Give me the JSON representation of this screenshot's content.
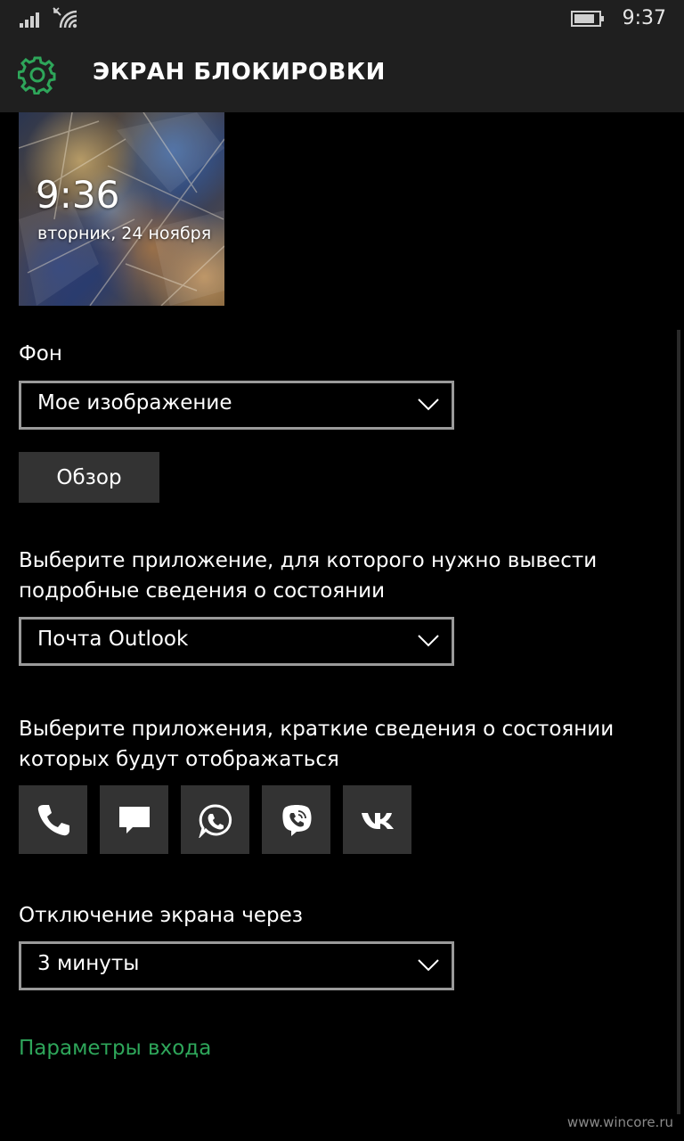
{
  "status_bar": {
    "time": "9:37"
  },
  "header": {
    "title": "ЭКРАН БЛОКИРОВКИ"
  },
  "preview": {
    "time": "9:36",
    "date": "вторник, 24 ноября"
  },
  "background": {
    "label": "Фон",
    "selected": "Мое изображение",
    "browse_label": "Обзор"
  },
  "detailed_status": {
    "label_line1": "Выберите приложение, для которого нужно вывести",
    "label_line2": "подробные сведения о состоянии",
    "selected": "Почта Outlook"
  },
  "quick_status": {
    "label_line1": "Выберите приложения, краткие сведения о состоянии",
    "label_line2": "которых будут отображаться",
    "apps": [
      "phone-icon",
      "message-icon",
      "whatsapp-icon",
      "viber-icon",
      "vk-icon"
    ]
  },
  "screen_timeout": {
    "label": "Отключение экрана через",
    "selected": "3 минуты"
  },
  "signin_link": "Параметры входа",
  "watermark": "www.wincore.ru",
  "colors": {
    "accent": "#2ea65a",
    "header_bg": "#1f1f1f",
    "tile_bg": "#333333",
    "border": "#9a9a9a"
  }
}
